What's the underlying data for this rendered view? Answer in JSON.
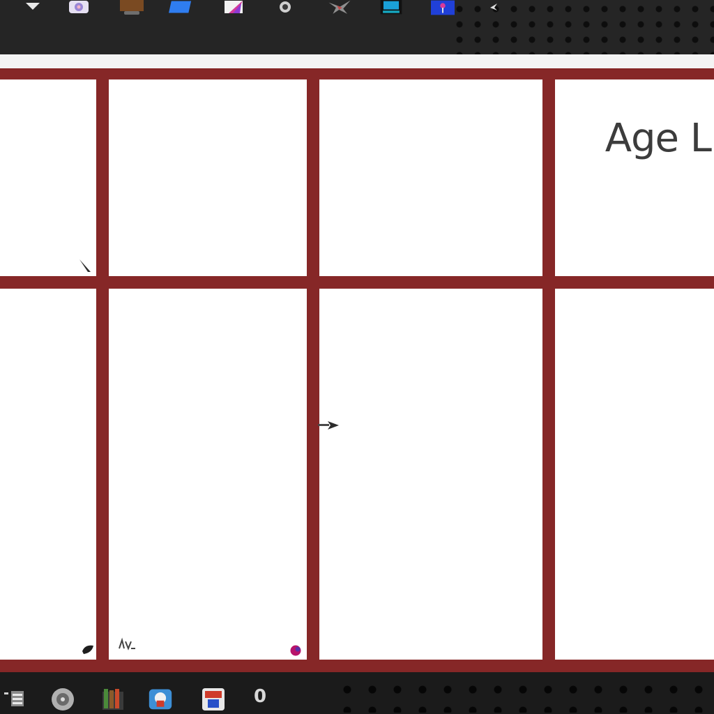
{
  "toolbar": {
    "icons": [
      {
        "name": "arrow-icon",
        "color": "#e8e8e8"
      },
      {
        "name": "photo-app-icon",
        "color": "#c9c0e6"
      },
      {
        "name": "folder-icon",
        "color": "#8a5a2b"
      },
      {
        "name": "blue-document-icon",
        "color": "#2f7df0"
      },
      {
        "name": "magenta-pen-icon",
        "color": "#d33a9a"
      },
      {
        "name": "tool-icon",
        "color": "#bdbdbd"
      },
      {
        "name": "star-icon",
        "color": "#9a9a9a"
      },
      {
        "name": "monitor-icon",
        "color": "#1aa0d8"
      },
      {
        "name": "blue-app-icon",
        "color": "#2040d8"
      },
      {
        "name": "chevron-icon",
        "color": "#e0e0e0"
      }
    ]
  },
  "board": {
    "background_color": "#862727",
    "cell_color": "#ffffff",
    "label": "Age L"
  },
  "taskbar": {
    "icons": [
      {
        "name": "menu-icon",
        "color": "#d0d0d0"
      },
      {
        "name": "disk-icon",
        "color": "#b8b8b8"
      },
      {
        "name": "books-icon",
        "color": "#4b8a3a"
      },
      {
        "name": "browser-icon",
        "color": "#3d8fd6"
      },
      {
        "name": "badge-app-icon",
        "color": "#cf3b2a"
      }
    ],
    "counter": "0"
  }
}
